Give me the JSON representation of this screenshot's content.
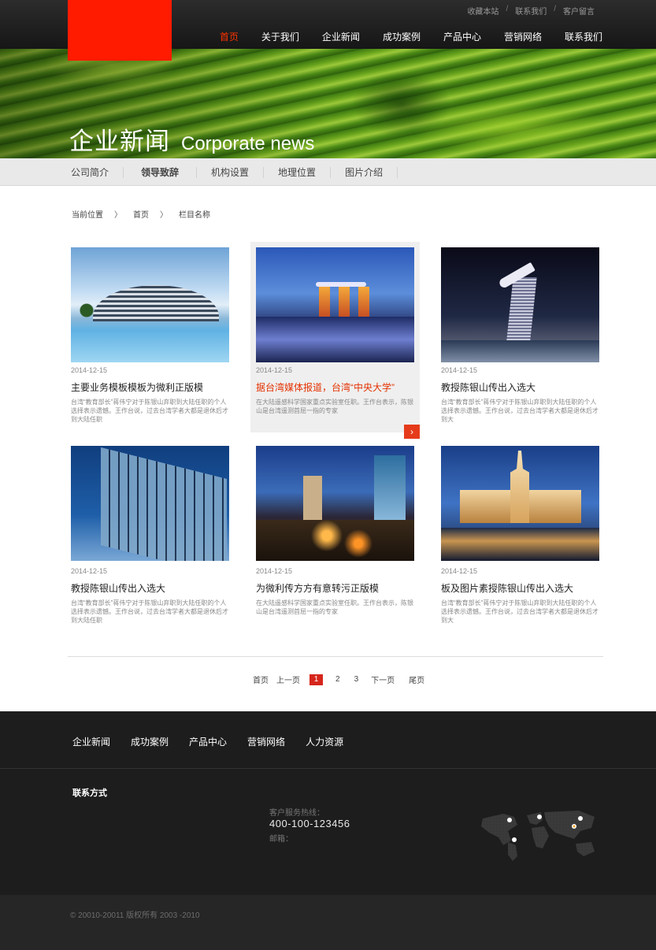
{
  "header": {
    "top_links": [
      "收藏本站",
      "联系我们",
      "客户留言"
    ],
    "top_separator": "/",
    "nav": [
      {
        "label": "首页",
        "active": true
      },
      {
        "label": "关于我们",
        "active": false
      },
      {
        "label": "企业新闻",
        "active": false
      },
      {
        "label": "成功案例",
        "active": false
      },
      {
        "label": "产品中心",
        "active": false
      },
      {
        "label": "营销网络",
        "active": false
      },
      {
        "label": "联系我们",
        "active": false
      }
    ],
    "accent_color": "#ff3300"
  },
  "banner": {
    "title_cn": "企业新闻",
    "title_en": "Corporate news"
  },
  "subnav": [
    {
      "label": "公司简介",
      "active": false
    },
    {
      "label": "领导致辞",
      "active": true
    },
    {
      "label": "机构设置",
      "active": false
    },
    {
      "label": "地理位置",
      "active": false
    },
    {
      "label": "图片介绍",
      "active": false
    }
  ],
  "breadcrumb": {
    "items": [
      "当前位置",
      "首页",
      "栏目名称"
    ],
    "separator": "〉"
  },
  "articles": [
    {
      "date": "2014-12-15",
      "title": "主要业务模板模板为微利正版模",
      "desc": "台湾“教育部长”蒋伟宁对于陈银山弃职到大陆任职的个人选择表示遗憾。王作台说，过去台湾学者大都是退休后才到大陆任职",
      "image": "resort-hotel-pool",
      "highlighted": false
    },
    {
      "date": "2014-12-15",
      "title": "据台湾媒体报道，台湾“中央大学”",
      "desc": "在大陆遥感科学国家重点实验室任职。王作台表示，陈银山是台湾遥测首屈一指的专家",
      "image": "singapore-skyline",
      "highlighted": true
    },
    {
      "date": "2014-12-15",
      "title": "教授陈银山传出入选大",
      "desc": "台湾“教育部长”蒋伟宁对于陈银山弃职到大陆任职的个人选择表示遗憾。王作台说，过去台湾学者大都是退休后才到大",
      "image": "marina-bay-sands",
      "highlighted": false
    },
    {
      "date": "2014-12-15",
      "title": "教授陈银山传出入选大",
      "desc": "台湾“教育部长”蒋伟宁对于陈银山弃职到大陆任职的个人选择表示遗憾。王作台说，过去台湾学者大都是退休后才到大陆任职",
      "image": "glass-office-building",
      "highlighted": false
    },
    {
      "date": "2014-12-15",
      "title": "为微利传方方有意转污正版模",
      "desc": "在大陆遥感科学国家重点实验室任职。王作台表示，陈银山是台湾遥测首屈一指的专家",
      "image": "city-night",
      "highlighted": false
    },
    {
      "date": "2014-12-15",
      "title": "板及图片素授陈银山传出入选大",
      "desc": "台湾“教育部长”蒋伟宁对于陈银山弃职到大陆任职的个人选择表示遗憾。王作台说，过去台湾学者大都是退休后才到大",
      "image": "moscow-university",
      "highlighted": false
    }
  ],
  "more_icon": "chevron-right-icon",
  "pagination": {
    "first": "首页",
    "prev": "上一页",
    "pages": [
      "1",
      "2",
      "3"
    ],
    "current": "1",
    "next": "下一页",
    "last": "尾页"
  },
  "footer": {
    "nav": [
      "企业新闻",
      "成功案例",
      "产品中心",
      "营销网络",
      "人力资源"
    ],
    "contact_title": "联系方式",
    "service_label": "客户服务热线：",
    "service_phone": "400-100-123456",
    "mail_label": "邮箱：",
    "map_icon": "world-map-icon",
    "copyright": "© 20010-20011 版权所有 2003 -2010"
  }
}
